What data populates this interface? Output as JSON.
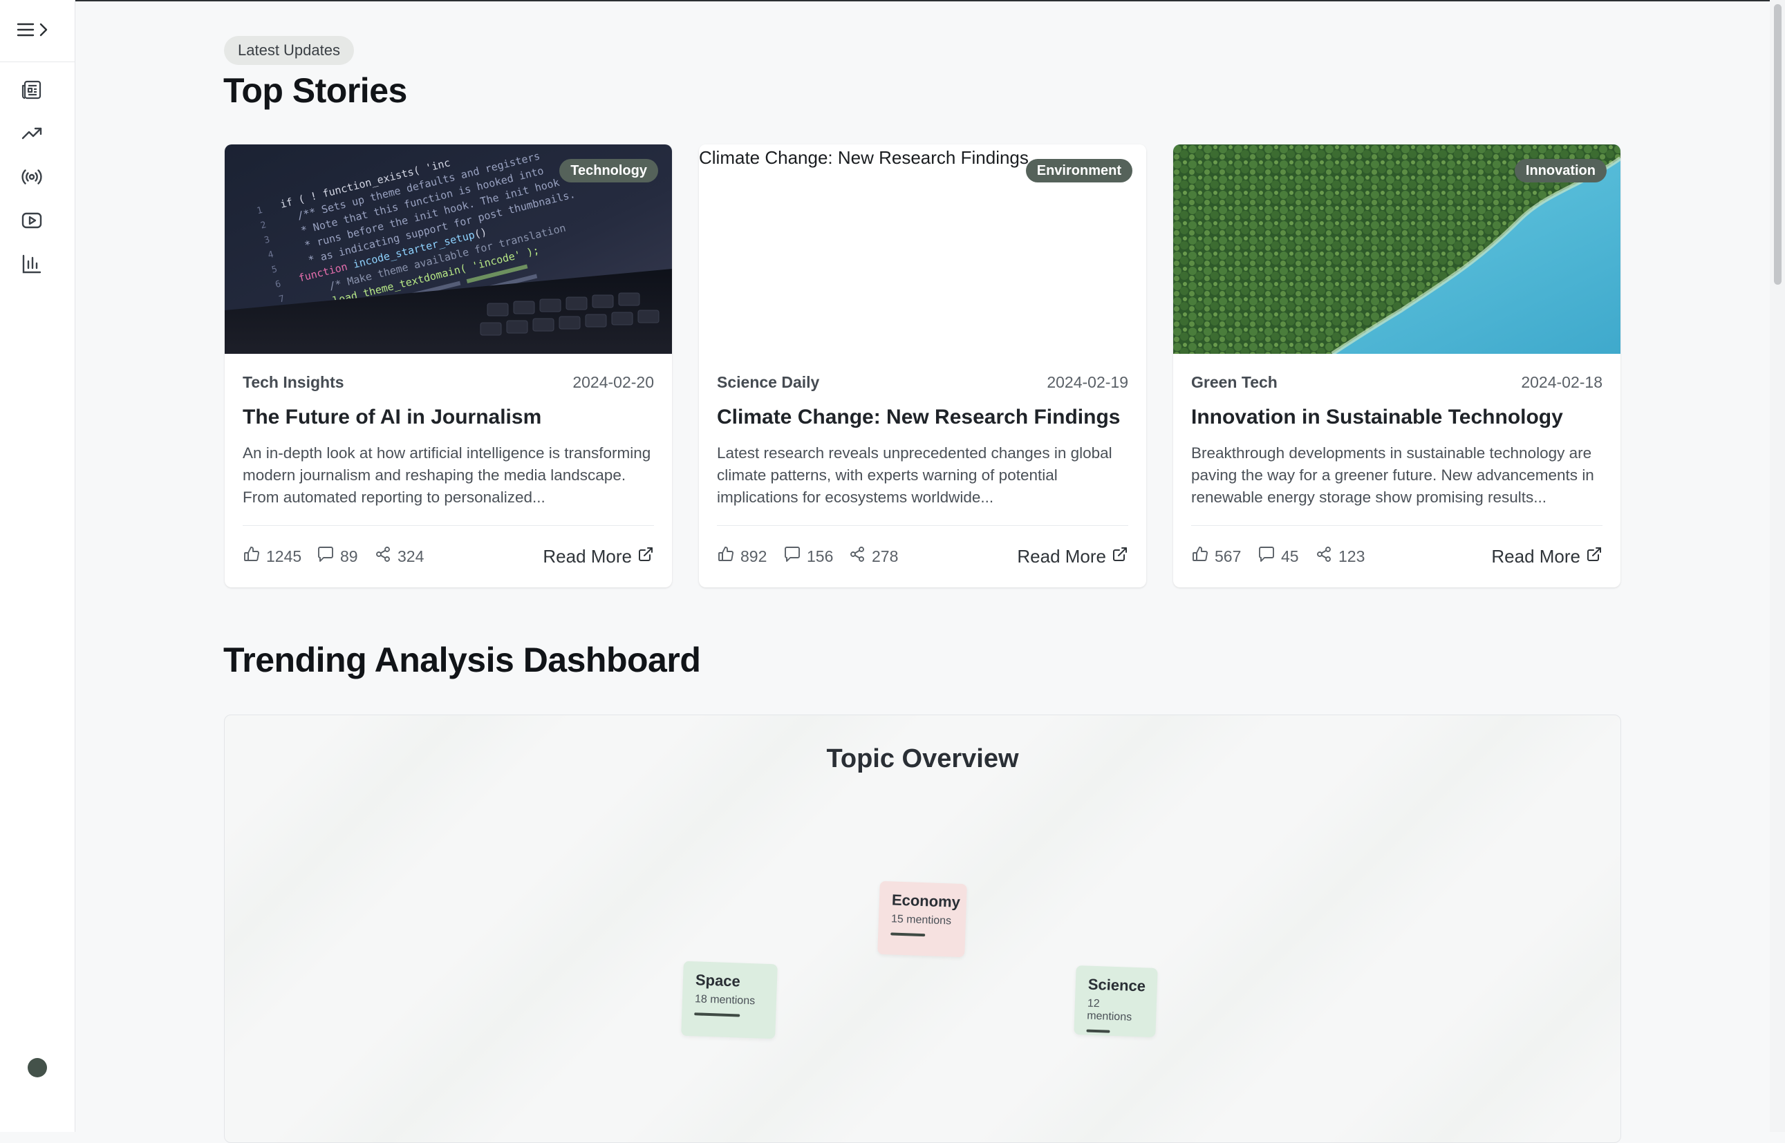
{
  "sidebar": {
    "toggle_icons": [
      "menu-icon",
      "chevron-right-icon"
    ],
    "items": [
      {
        "name": "newspaper-icon"
      },
      {
        "name": "trending-up-icon"
      },
      {
        "name": "broadcast-icon"
      },
      {
        "name": "video-icon"
      },
      {
        "name": "bar-chart-icon"
      }
    ]
  },
  "header": {
    "pill": "Latest Updates",
    "title": "Top Stories"
  },
  "stories": [
    {
      "badge": "Technology",
      "source": "Tech Insights",
      "date": "2024-02-20",
      "title": "The Future of AI in Journalism",
      "excerpt": "An in-depth look at how artificial intelligence is transforming modern journalism and reshaping the media landscape. From automated reporting to personalized...",
      "likes": "1245",
      "comments": "89",
      "shares": "324",
      "read_more": "Read More"
    },
    {
      "badge": "Environment",
      "image_alt": "Climate Change: New Research Findings",
      "source": "Science Daily",
      "date": "2024-02-19",
      "title": "Climate Change: New Research Findings",
      "excerpt": "Latest research reveals unprecedented changes in global climate patterns, with experts warning of potential implications for ecosystems worldwide...",
      "likes": "892",
      "comments": "156",
      "shares": "278",
      "read_more": "Read More"
    },
    {
      "badge": "Innovation",
      "source": "Green Tech",
      "date": "2024-02-18",
      "title": "Innovation in Sustainable Technology",
      "excerpt": "Breakthrough developments in sustainable technology are paving the way for a greener future. New advancements in renewable energy storage show promising results...",
      "likes": "567",
      "comments": "45",
      "shares": "123",
      "read_more": "Read More"
    }
  ],
  "dashboard": {
    "title": "Trending Analysis Dashboard",
    "panel_title": "Topic Overview",
    "topics": [
      {
        "name": "Economy",
        "mentions": "15 mentions"
      },
      {
        "name": "Space",
        "mentions": "18 mentions"
      },
      {
        "name": "Science",
        "mentions": "12 mentions"
      }
    ]
  },
  "colors": {
    "badge": "#55625a",
    "economy_card": "#f6e1e0",
    "space_card": "#dcede0",
    "science_card": "#dcede0",
    "theme_dot": "#44524a"
  }
}
